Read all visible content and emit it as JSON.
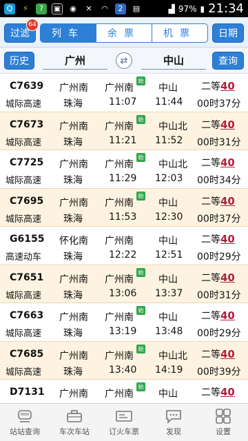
{
  "status_bar": {
    "battery": "97%",
    "time": "21:34",
    "notification_count": "2"
  },
  "toolbar": {
    "filter_label": "过滤",
    "filter_badge": "64",
    "tabs": [
      {
        "label": "列车",
        "active": true
      },
      {
        "label": "余票",
        "active": false
      },
      {
        "label": "机票",
        "active": false
      }
    ],
    "date_label": "日期"
  },
  "search": {
    "history_label": "历史",
    "from": "广州",
    "to": "中山",
    "query_label": "查询",
    "swap_icon": "swap-icon"
  },
  "trains": [
    {
      "code": "C7639",
      "type": "城际高速",
      "origin": "广州南",
      "dest": "珠海",
      "dep_station": "广州南",
      "dep_time": "11:07",
      "arr_station": "中山",
      "arr_time": "11:44",
      "seat_class": "二等",
      "seat_count": "40",
      "duration": "00时37分",
      "start_badge": "始"
    },
    {
      "code": "C7673",
      "type": "城际高速",
      "origin": "广州南",
      "dest": "珠海",
      "dep_station": "广州南",
      "dep_time": "11:21",
      "arr_station": "中山北",
      "arr_time": "11:52",
      "seat_class": "二等",
      "seat_count": "40",
      "duration": "00时31分",
      "start_badge": "始"
    },
    {
      "code": "C7725",
      "type": "城际高速",
      "origin": "广州南",
      "dest": "珠海",
      "dep_station": "广州南",
      "dep_time": "11:29",
      "arr_station": "中山北",
      "arr_time": "12:03",
      "seat_class": "二等",
      "seat_count": "40",
      "duration": "00时34分",
      "start_badge": "始"
    },
    {
      "code": "C7695",
      "type": "城际高速",
      "origin": "广州南",
      "dest": "珠海",
      "dep_station": "广州南",
      "dep_time": "11:53",
      "arr_station": "中山",
      "arr_time": "12:30",
      "seat_class": "二等",
      "seat_count": "40",
      "duration": "00时37分",
      "start_badge": "始"
    },
    {
      "code": "G6155",
      "type": "高速动车",
      "origin": "怀化南",
      "dest": "珠海",
      "dep_station": "广州南",
      "dep_time": "12:22",
      "arr_station": "中山",
      "arr_time": "12:51",
      "seat_class": "二等",
      "seat_count": "40",
      "duration": "00时29分",
      "start_badge": ""
    },
    {
      "code": "C7651",
      "type": "城际高速",
      "origin": "广州南",
      "dest": "珠海",
      "dep_station": "广州南",
      "dep_time": "13:06",
      "arr_station": "中山",
      "arr_time": "13:37",
      "seat_class": "二等",
      "seat_count": "40",
      "duration": "00时31分",
      "start_badge": "始"
    },
    {
      "code": "C7663",
      "type": "城际高速",
      "origin": "广州南",
      "dest": "珠海",
      "dep_station": "广州南",
      "dep_time": "13:19",
      "arr_station": "中山",
      "arr_time": "13:48",
      "seat_class": "二等",
      "seat_count": "40",
      "duration": "00时29分",
      "start_badge": "始"
    },
    {
      "code": "C7685",
      "type": "城际高速",
      "origin": "广州南",
      "dest": "珠海",
      "dep_station": "广州南",
      "dep_time": "13:40",
      "arr_station": "中山北",
      "arr_time": "14:19",
      "seat_class": "二等",
      "seat_count": "40",
      "duration": "00时39分",
      "start_badge": "始"
    },
    {
      "code": "D7131",
      "type": "",
      "origin": "广州南",
      "dest": "",
      "dep_station": "广州南",
      "dep_time": "",
      "arr_station": "中山",
      "arr_time": "",
      "seat_class": "二等",
      "seat_count": "40",
      "duration": "",
      "start_badge": "始"
    }
  ],
  "bottom_nav": [
    {
      "label": "站站查询",
      "icon": "train-icon"
    },
    {
      "label": "车次车站",
      "icon": "briefcase-icon"
    },
    {
      "label": "订火车票",
      "icon": "ticket-icon"
    },
    {
      "label": "发现",
      "icon": "chat-icon"
    },
    {
      "label": "设置",
      "icon": "grid-icon"
    }
  ]
}
